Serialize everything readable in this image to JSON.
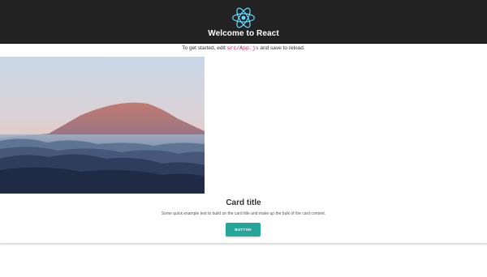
{
  "header": {
    "title": "Welcome to React",
    "logo_icon": "react-logo-icon",
    "logo_color": "#61dafb",
    "background": "#222222"
  },
  "intro": {
    "before": "To get started, edit ",
    "code": "src/App.js",
    "after": " and save to reload."
  },
  "card": {
    "image": "mountain-landscape-image",
    "title": "Card title",
    "text": "Some quick example text to build on the card title and make up the bulk of the card content.",
    "button_label": "Button",
    "button_color": "#26a69a"
  }
}
